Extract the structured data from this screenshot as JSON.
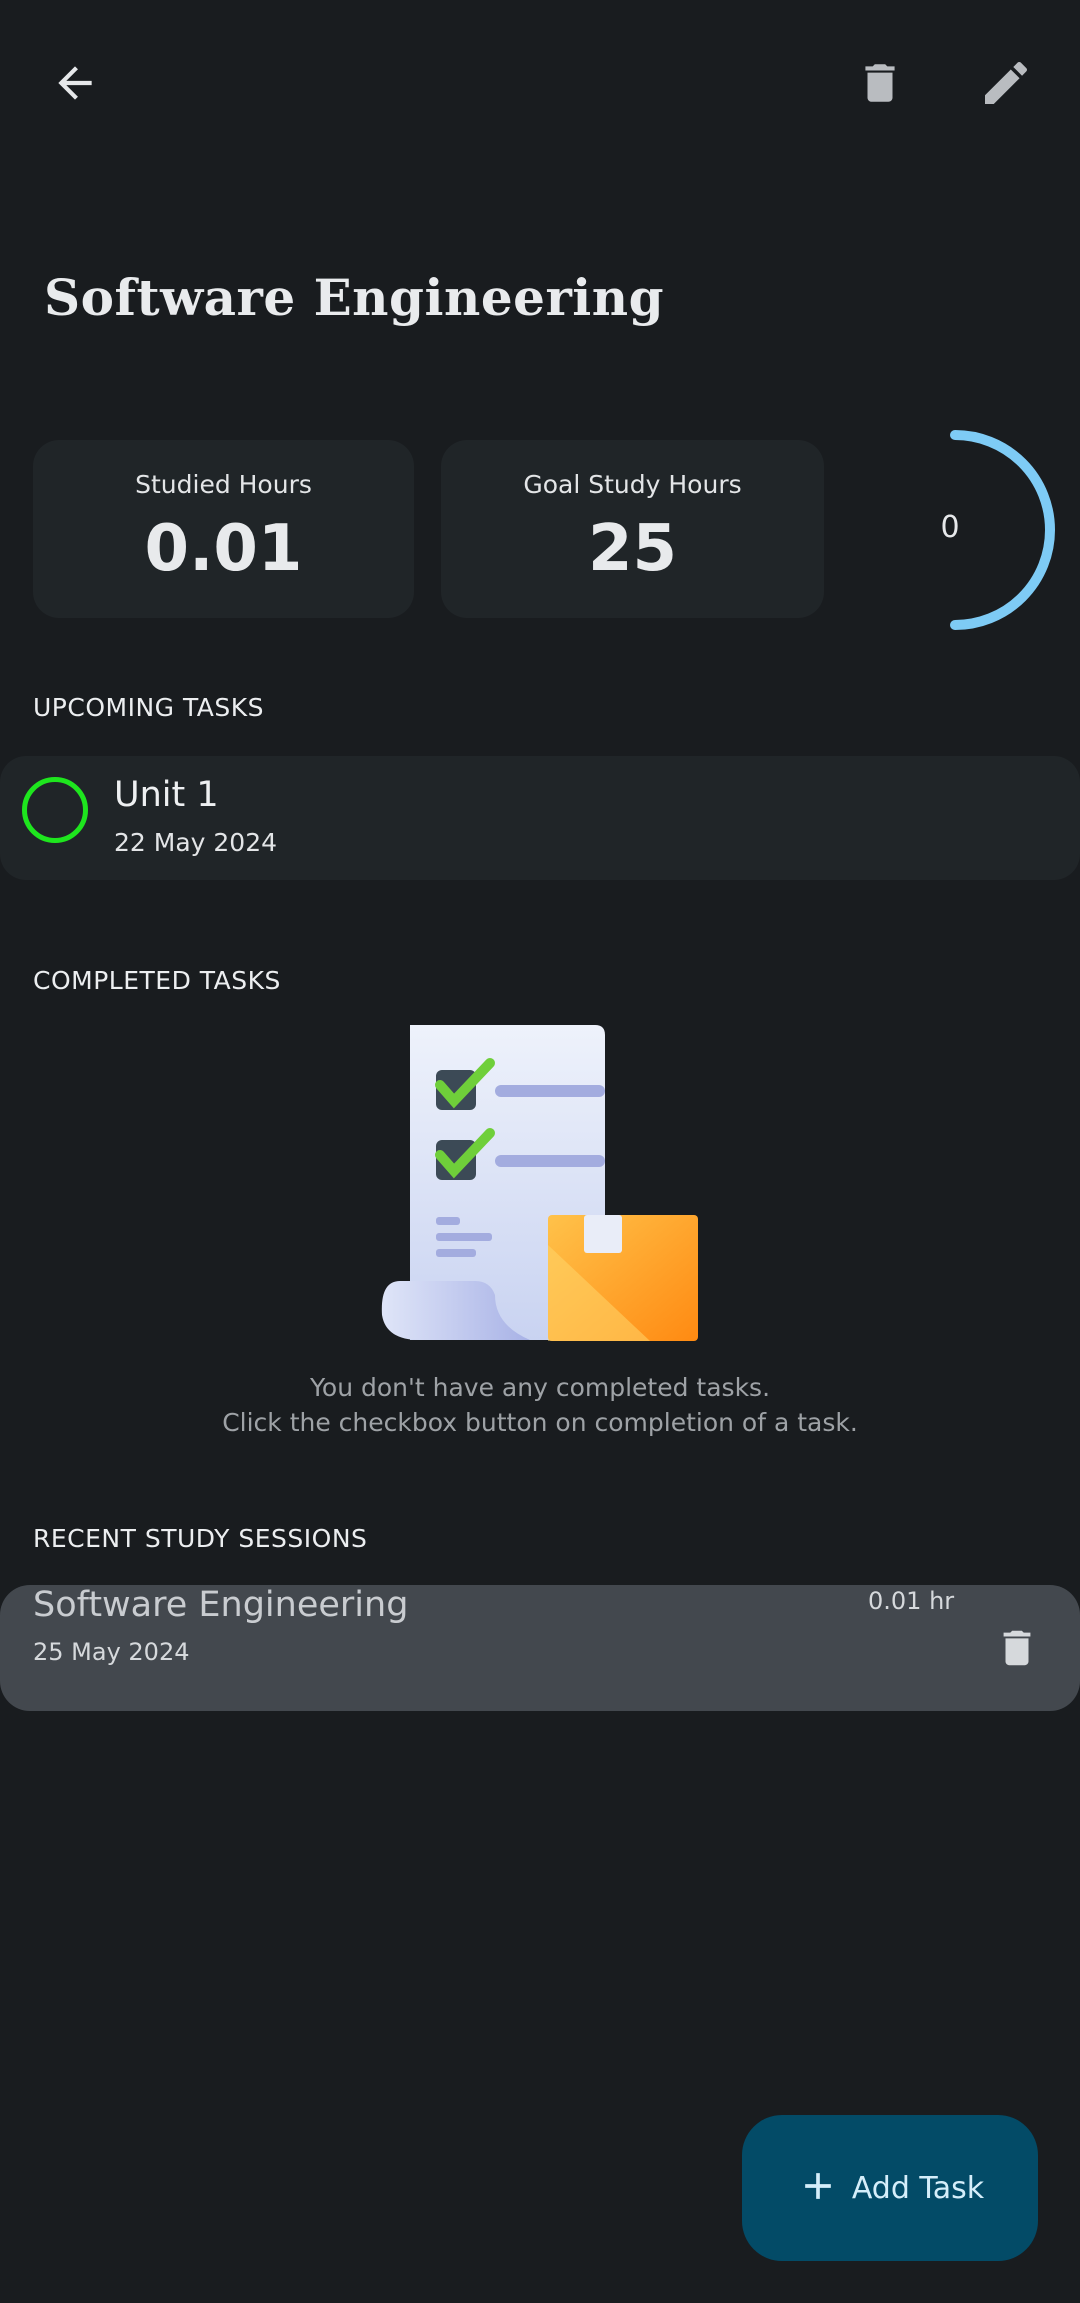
{
  "header": {
    "back_icon": "arrow-left-icon",
    "delete_icon": "trash-icon",
    "edit_icon": "pencil-icon",
    "title": "Software Engineering"
  },
  "stats": {
    "studied_label": "Studied Hours",
    "studied_value": "0.01",
    "goal_label": "Goal Study Hours",
    "goal_value": "25",
    "progress_text": "0",
    "progress_fraction": 0,
    "ring_color": "#7ecbf5"
  },
  "upcoming": {
    "header": "UPCOMING TASKS",
    "tasks": [
      {
        "title": "Unit 1",
        "date": "22 May 2024",
        "checkbox_color": "#1ee61e"
      }
    ]
  },
  "completed": {
    "header": "COMPLETED TASKS",
    "illustration_icon": "checklist-with-package-illustration",
    "empty_line1": "You don't have any completed tasks.",
    "empty_line2": "Click the checkbox button on completion of a task."
  },
  "sessions": {
    "header": "RECENT STUDY SESSIONS",
    "items": [
      {
        "title": "Software Engineering",
        "date": "25 May 2024",
        "hours": "0.01 hr",
        "delete_icon": "trash-icon"
      }
    ]
  },
  "fab": {
    "icon": "plus-icon",
    "label": "Add Task",
    "color": "#034b67"
  }
}
